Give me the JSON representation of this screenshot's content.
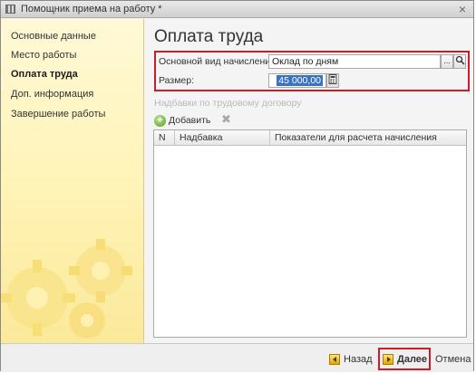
{
  "window": {
    "title": "Помощник приема на работу *",
    "close_glyph": "×"
  },
  "sidebar": {
    "items": [
      {
        "label": "Основные данные",
        "active": false
      },
      {
        "label": "Место работы",
        "active": false
      },
      {
        "label": "Оплата труда",
        "active": true
      },
      {
        "label": "Доп. информация",
        "active": false
      },
      {
        "label": "Завершение работы",
        "active": false
      }
    ]
  },
  "main": {
    "title": "Оплата труда",
    "accrual": {
      "label": "Основной вид начисления:",
      "value": "Оклад по дням",
      "select_glyph": "...",
      "search_icon": "search-icon"
    },
    "amount": {
      "label": "Размер:",
      "value": "45 000,00",
      "calc_icon": "calculator-icon"
    },
    "allowances": {
      "section_title": "Надбавки по трудовому договору",
      "add_label": "Добавить",
      "add_glyph": "+",
      "delete_glyph": "✖",
      "columns": [
        "N",
        "Надбавка",
        "Показатели для расчета начисления"
      ],
      "rows": []
    }
  },
  "footer": {
    "back_label": "Назад",
    "next_label": "Далее",
    "cancel_label": "Отмена"
  },
  "colors": {
    "highlight": "#c81e2a",
    "sidebar_bg": "#fff3b5",
    "selection": "#3b73c4"
  }
}
